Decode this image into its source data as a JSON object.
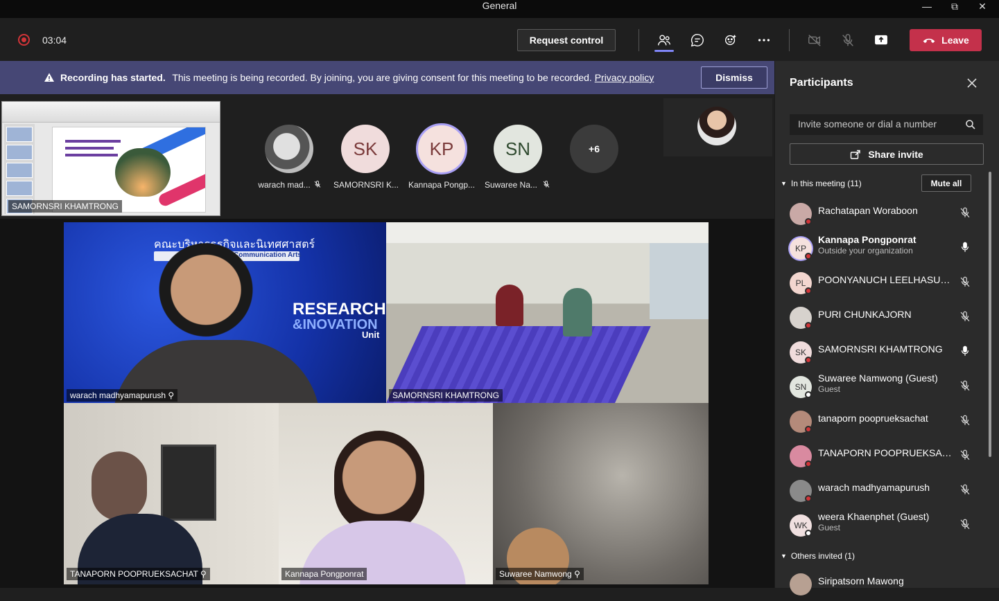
{
  "window": {
    "title": "General",
    "controls": [
      "minimize",
      "restore",
      "close"
    ]
  },
  "toolbar": {
    "timer": "03:04",
    "request_control": "Request control",
    "leave": "Leave",
    "icons": [
      "participants-icon",
      "chat-icon",
      "reactions-icon",
      "more-icon",
      "camera-off-icon",
      "mic-off-icon",
      "share-icon"
    ]
  },
  "banner": {
    "title": "Recording has started.",
    "message": "This meeting is being recorded. By joining, you are giving consent for this meeting to be recorded.",
    "link": "Privacy policy",
    "dismiss": "Dismiss"
  },
  "stage": {
    "shared_screen_label": "SAMORNSRI KHAMTRONG",
    "bubbles": [
      {
        "initials": "",
        "name": "warach mad...",
        "muted": true,
        "bg": "#d9d9d9"
      },
      {
        "initials": "SK",
        "name": "SAMORNSRI K...",
        "muted": false,
        "bg": "#f0dcdc"
      },
      {
        "initials": "KP",
        "name": "Kannapa Pongp...",
        "muted": false,
        "bg": "#f5e1de",
        "speaking": true
      },
      {
        "initials": "SN",
        "name": "Suwaree Na...",
        "muted": true,
        "bg": "#e2e6df"
      }
    ],
    "overflow": "+6"
  },
  "video_grid": [
    {
      "name": "warach madhyamapurush",
      "muted": true
    },
    {
      "name": "SAMORNSRI KHAMTRONG",
      "muted": false
    },
    {
      "name": "TANAPORN POOPRUEKSACHAT",
      "muted": true
    },
    {
      "name": "Kannapa  Pongponrat",
      "muted": false
    },
    {
      "name": "Suwaree Namwong",
      "muted": true
    }
  ],
  "video_text": {
    "faculty_line": "คณะบริหารธุรกิจและนิเทศศาสตร์",
    "comm_arts": "Communication Arts",
    "research": "RESEARCH",
    "innovation": "&INOVATION",
    "unit": "Unit"
  },
  "participants_panel": {
    "title": "Participants",
    "invite_placeholder": "Invite someone or dial a number",
    "share_invite": "Share invite",
    "in_meeting": "In this meeting (11)",
    "mute_all": "Mute all",
    "others_invited": "Others invited (1)",
    "people": [
      {
        "initials": "",
        "name": "Rachatapan Woraboon",
        "sub": "",
        "mic": "off",
        "bg": "#c9a9a6"
      },
      {
        "initials": "KP",
        "name": "Kannapa Pongponrat",
        "sub": "Outside your organization",
        "mic": "on",
        "bg": "#f5e1de",
        "bold": true
      },
      {
        "initials": "PL",
        "name": "POONYANUCH LEELHASUWAN",
        "sub": "",
        "mic": "off",
        "bg": "#f3d6cf"
      },
      {
        "initials": "",
        "name": "PURI CHUNKAJORN",
        "sub": "",
        "mic": "off",
        "bg": "#d7d2cd"
      },
      {
        "initials": "SK",
        "name": "SAMORNSRI KHAMTRONG",
        "sub": "",
        "mic": "on",
        "bg": "#f0dcdc"
      },
      {
        "initials": "SN",
        "name": "Suwaree Namwong (Guest)",
        "sub": "Guest",
        "mic": "off",
        "bg": "#e2e6df"
      },
      {
        "initials": "",
        "name": "tanaporn pooprueksachat",
        "sub": "",
        "mic": "off",
        "bg": "#b48a7a"
      },
      {
        "initials": "",
        "name": "TANAPORN POOPRUEKSACH...",
        "sub": "",
        "mic": "off",
        "bg": "#d98aa0"
      },
      {
        "initials": "",
        "name": "warach madhyamapurush",
        "sub": "",
        "mic": "off",
        "bg": "#8a8a8a"
      },
      {
        "initials": "WK",
        "name": "weera Khaenphet (Guest)",
        "sub": "Guest",
        "mic": "off",
        "bg": "#f0e0e0"
      }
    ],
    "invited": [
      {
        "name": "Siripatsorn Mawong"
      }
    ]
  },
  "colors": {
    "accent": "#7f85f5",
    "leave": "#c4314b",
    "banner": "#464775",
    "recording": "#d13438"
  }
}
